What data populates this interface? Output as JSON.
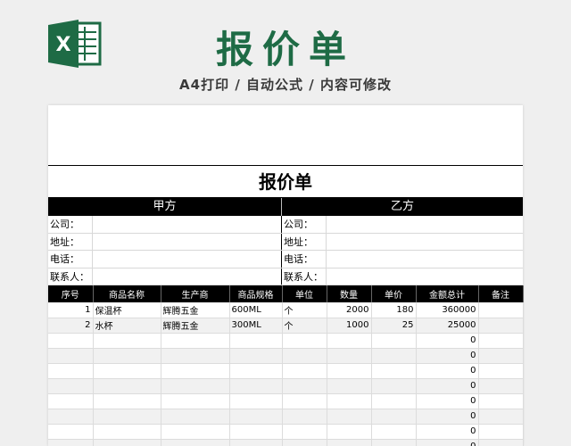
{
  "header": {
    "title": "报价单",
    "subtitle": "A4打印 / 自动公式 / 内容可修改",
    "logo_icon": "excel-logo-icon",
    "logo_letter": "X",
    "brand_color": "#1e6b45"
  },
  "sheet": {
    "doc_title": "报价单",
    "party_a": "甲方",
    "party_b": "乙方",
    "info_rows": [
      {
        "a": "公司：",
        "b": "公司："
      },
      {
        "a": "地址：",
        "b": "地址："
      },
      {
        "a": "电话：",
        "b": "电话："
      },
      {
        "a": "联系人：",
        "b": "联系人："
      }
    ],
    "columns": [
      "序号",
      "商品名称",
      "生产商",
      "商品规格",
      "单位",
      "数量",
      "单价",
      "金额总计",
      "备注"
    ],
    "rows": [
      {
        "no": "1",
        "name": "保温杯",
        "maker": "辉腾五金",
        "spec": "600ML",
        "unit": "个",
        "qty": "2000",
        "price": "180",
        "total": "360000",
        "note": ""
      },
      {
        "no": "2",
        "name": "水杯",
        "maker": "辉腾五金",
        "spec": "300ML",
        "unit": "个",
        "qty": "1000",
        "price": "25",
        "total": "25000",
        "note": ""
      },
      {
        "no": "",
        "name": "",
        "maker": "",
        "spec": "",
        "unit": "",
        "qty": "",
        "price": "",
        "total": "0",
        "note": ""
      },
      {
        "no": "",
        "name": "",
        "maker": "",
        "spec": "",
        "unit": "",
        "qty": "",
        "price": "",
        "total": "0",
        "note": ""
      },
      {
        "no": "",
        "name": "",
        "maker": "",
        "spec": "",
        "unit": "",
        "qty": "",
        "price": "",
        "total": "0",
        "note": ""
      },
      {
        "no": "",
        "name": "",
        "maker": "",
        "spec": "",
        "unit": "",
        "qty": "",
        "price": "",
        "total": "0",
        "note": ""
      },
      {
        "no": "",
        "name": "",
        "maker": "",
        "spec": "",
        "unit": "",
        "qty": "",
        "price": "",
        "total": "0",
        "note": ""
      },
      {
        "no": "",
        "name": "",
        "maker": "",
        "spec": "",
        "unit": "",
        "qty": "",
        "price": "",
        "total": "0",
        "note": ""
      },
      {
        "no": "",
        "name": "",
        "maker": "",
        "spec": "",
        "unit": "",
        "qty": "",
        "price": "",
        "total": "0",
        "note": ""
      },
      {
        "no": "",
        "name": "",
        "maker": "",
        "spec": "",
        "unit": "",
        "qty": "",
        "price": "",
        "total": "0",
        "note": ""
      }
    ]
  }
}
